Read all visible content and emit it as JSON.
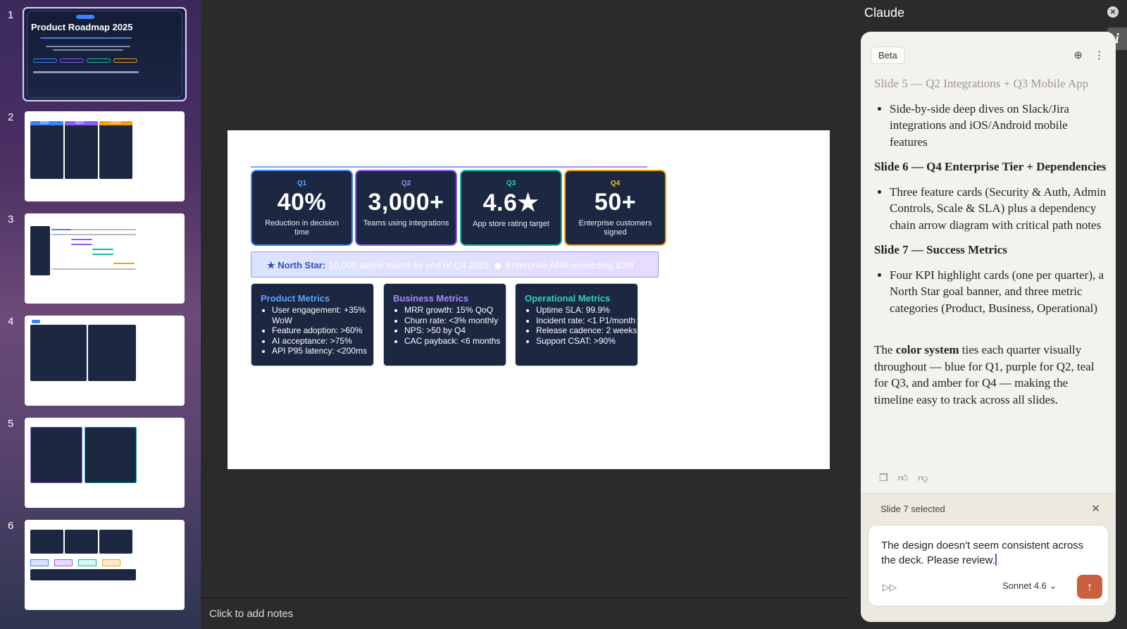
{
  "thumbnails": {
    "numbers": [
      "1",
      "2",
      "3",
      "4",
      "5",
      "6"
    ],
    "slide1_title": "Product Roadmap 2025",
    "slide2_labels": [
      "NOW",
      "NEXT",
      "LATER"
    ]
  },
  "slide": {
    "kpis": [
      {
        "quarter": "Q1",
        "value": "40%",
        "label": "Reduction in decision time",
        "color": "#3b82f6"
      },
      {
        "quarter": "Q2",
        "value": "3,000+",
        "label": "Teams using integrations",
        "color": "#8b5cf6"
      },
      {
        "quarter": "Q3",
        "value": "4.6★",
        "label": "App store rating target",
        "color": "#14b8a6"
      },
      {
        "quarter": "Q4",
        "value": "50+",
        "label": "Enterprise customers signed",
        "color": "#f59e0b"
      }
    ],
    "north_star": {
      "label": "★ North Star:",
      "text1": "10,000 active teams by end of Q4 2025",
      "text2": "Enterprise ARR exceeding $2M"
    },
    "metrics": [
      {
        "title": "Product Metrics",
        "color": "#60a5fa",
        "items": [
          "User engagement: +35% WoW",
          "Feature adoption: >60%",
          "AI acceptance: >75%",
          "API P95 latency: <200ms"
        ]
      },
      {
        "title": "Business Metrics",
        "color": "#a78bfa",
        "items": [
          "MRR growth: 15% QoQ",
          "Churn rate: <3% monthly",
          "NPS: >50 by Q4",
          "CAC payback: <6 months"
        ]
      },
      {
        "title": "Operational Metrics",
        "color": "#2dd4bf",
        "items": [
          "Uptime SLA: 99.9%",
          "Incident rate: <1 P1/month",
          "Release cadence: 2 weeks",
          "Support CSAT: >90%"
        ]
      }
    ]
  },
  "notes_placeholder": "Click to add notes",
  "claude": {
    "title": "Claude",
    "beta": "Beta",
    "message": {
      "faded_heading": "Slide 5 — Q2 Integrations + Q3 Mobile App",
      "bullet5": "Side-by-side deep dives on Slack/Jira integrations and iOS/Android mobile features",
      "heading6": "Slide 6 — Q4 Enterprise Tier + Dependencies",
      "bullet6": "Three feature cards (Security & Auth, Admin Controls, Scale & SLA) plus a dependency chain arrow diagram with critical path notes",
      "heading7": "Slide 7 — Success Metrics",
      "bullet7": "Four KPI highlight cards (one per quarter), a North Star goal banner, and three metric categories (Product, Business, Operational)",
      "para_prefix": "The ",
      "para_bold": "color system",
      "para_rest": " ties each quarter visually throughout — blue for Q1, purple for Q2, teal for Q3, and amber for Q4 — making the timeline easy to track across all slides."
    },
    "selection": "Slide 7 selected",
    "input_text": "The design doesn't seem consistent across the deck. Please review.",
    "model": "Sonnet 4.6"
  }
}
